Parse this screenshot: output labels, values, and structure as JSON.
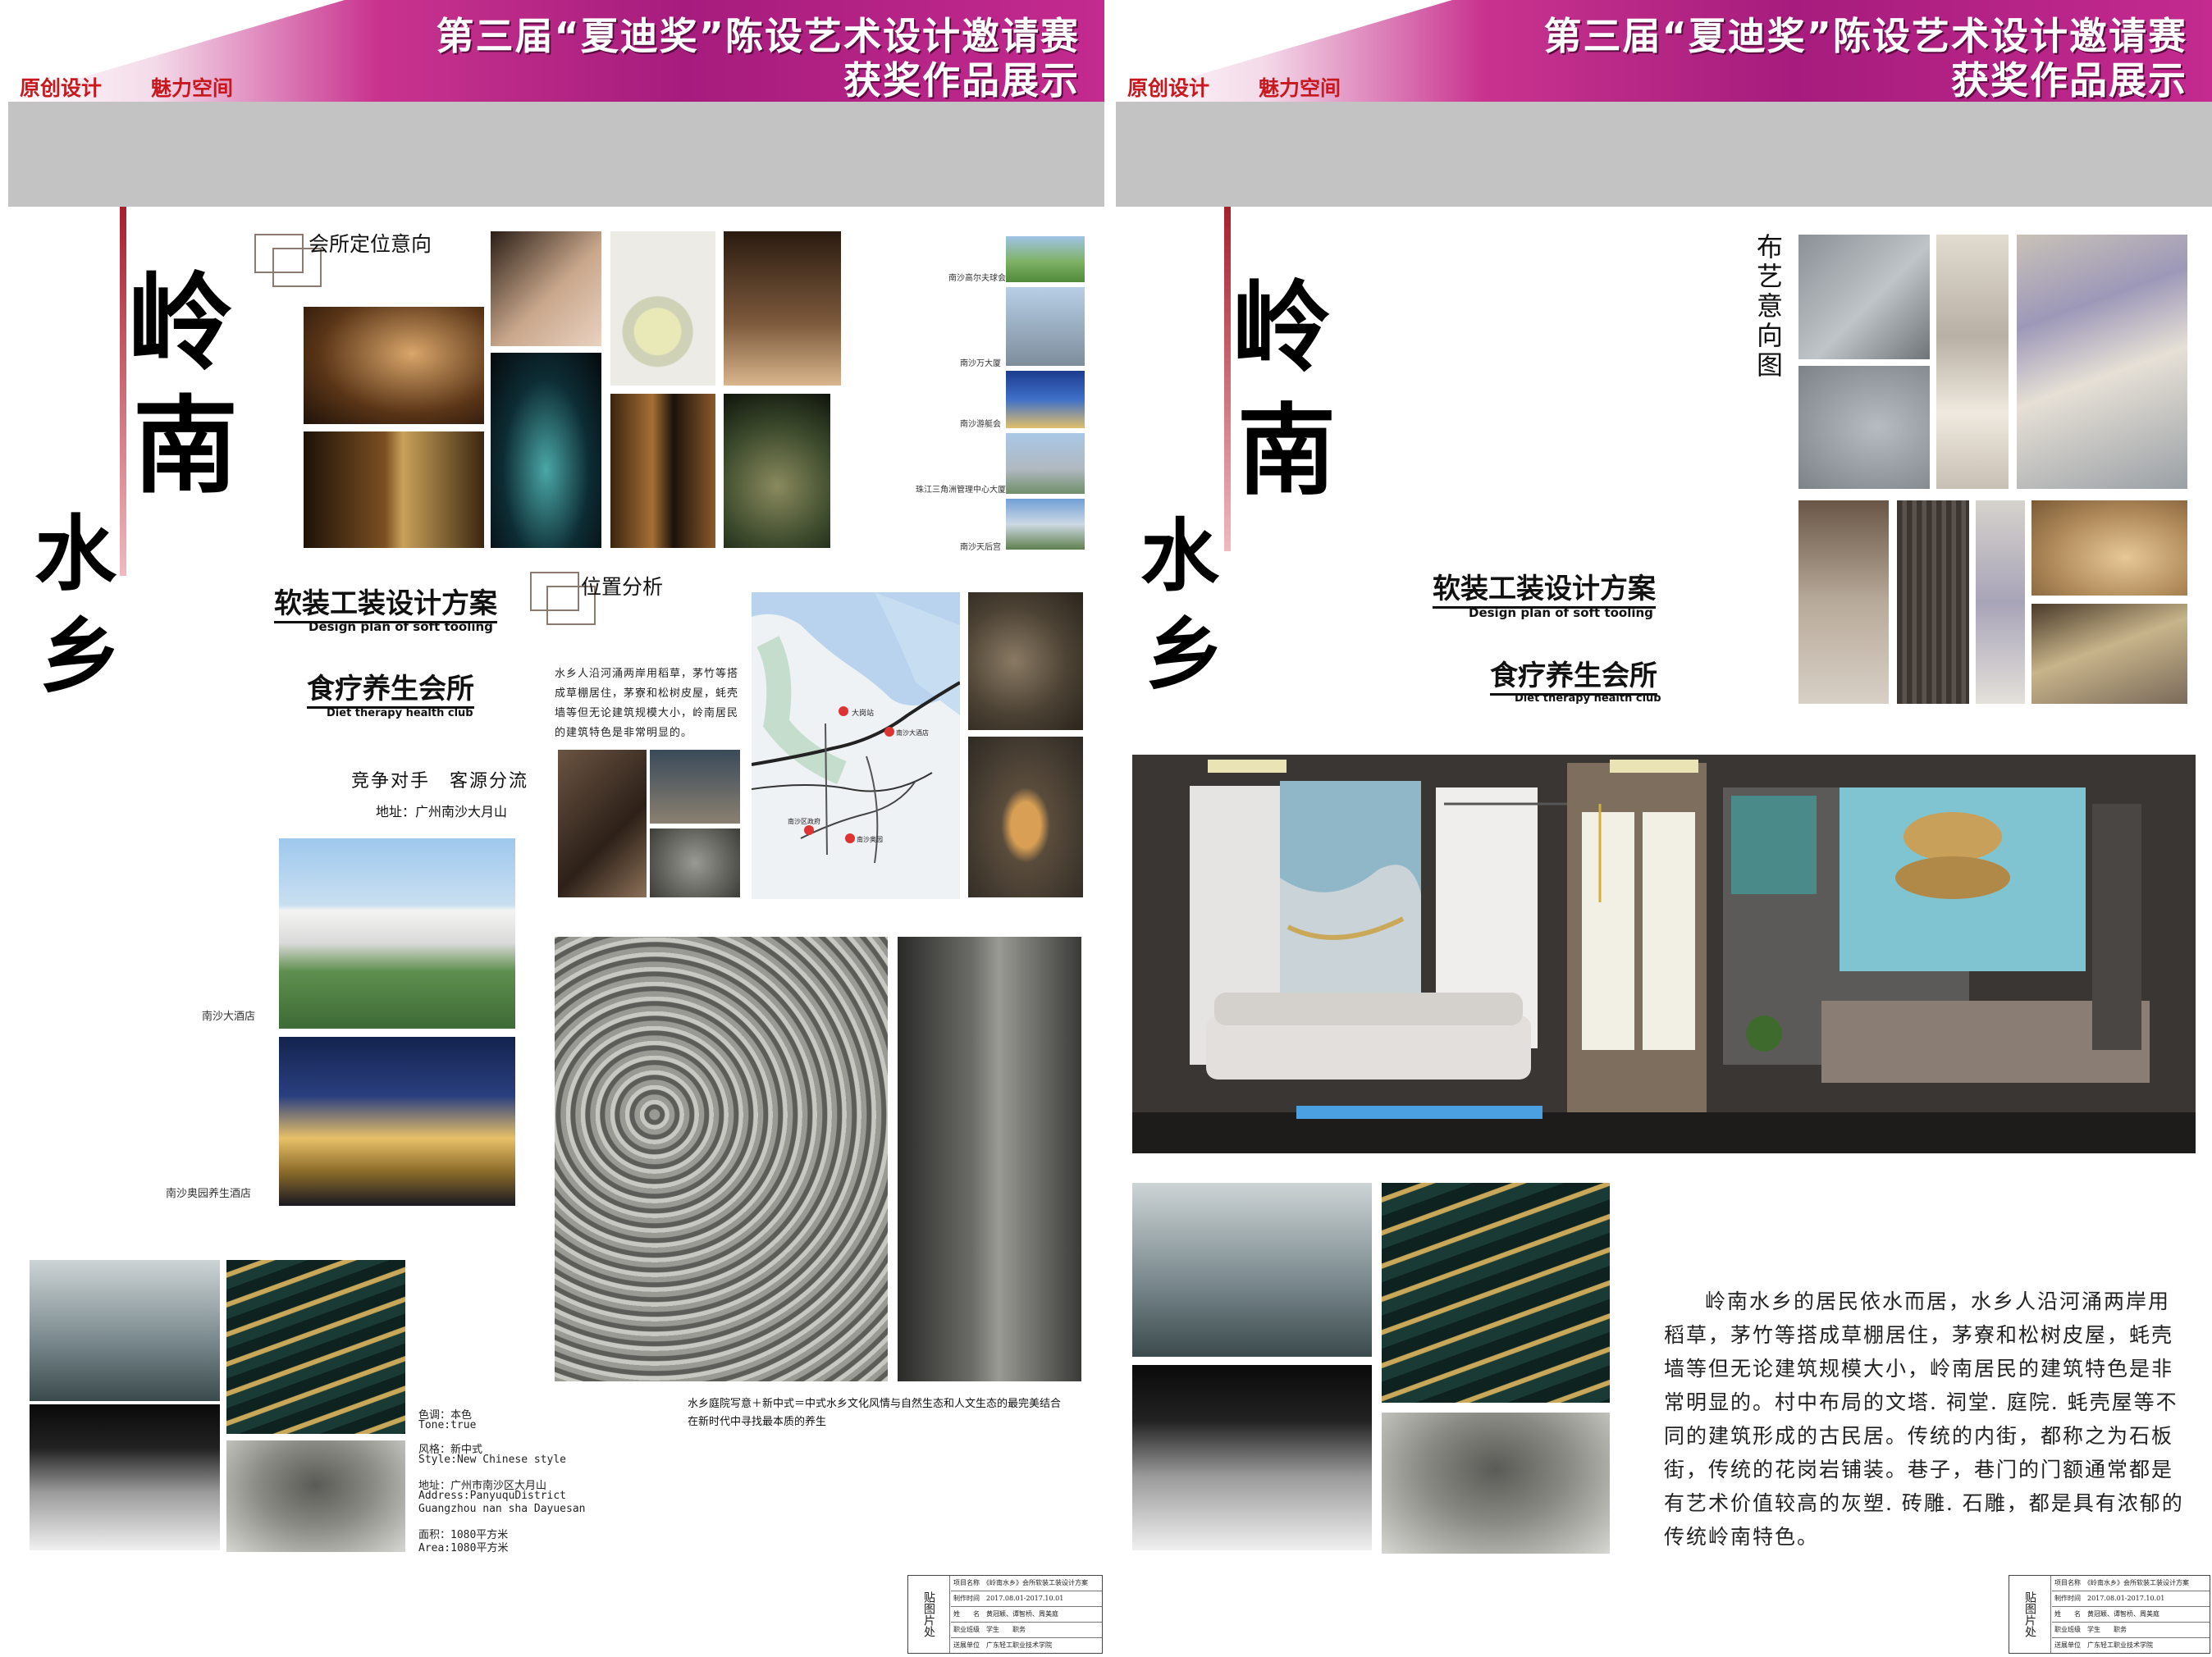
{
  "banner": {
    "line1": "第三届“夏迪奖”陈设艺术设计邀请赛",
    "line2": "获奖作品展示",
    "tag1": "原创设计",
    "tag2": "魅力空间"
  },
  "left_board": {
    "title_chars": [
      "岭",
      "南",
      "水",
      "乡"
    ],
    "section_positioning": "会所定位意向",
    "section_location": "位置分析",
    "plan_title_cn": "软装工装设计方案",
    "plan_title_en": "Design plan of soft tooling",
    "club_title_cn": "食疗养生会所",
    "club_title_en": "Diet therapy health club",
    "competitor": "竞争对手　客源分流",
    "address_line": "地址：广州南沙大月山",
    "hotel1": "南沙大酒店",
    "hotel2": "南沙奥园养生酒店",
    "side_captions": [
      "南沙高尔夫球会",
      "南沙万大厦",
      "南沙游艇会",
      "珠江三角洲管理中心大厦",
      "南沙天后宫"
    ],
    "location_text": "水乡人沿河涌两岸用稻草，茅竹等搭成草棚居住，茅寮和松树皮屋，蚝壳墙等但无论建筑规模大小，岭南居民的建筑特色是非常明显的。",
    "concept_line1": "水乡庭院写意＋新中式＝中式水乡文化风情与自然生态和人文生态的最完美结合",
    "concept_line2": "在新时代中寻找最本质的养生",
    "specs": {
      "tone": "色调：本色",
      "tone_en": "Tone:true",
      "style": "风格：新中式",
      "style_en": "Style:New Chinese style",
      "addr": "地址：广州市南沙区大月山",
      "addr_en1": "Address:PanyuquDistrict",
      "addr_en2": "Guangzhou nan sha Dayuesan",
      "area": "面积：1080平方米",
      "area_en": "Area:1080平方米"
    },
    "map_labels": [
      "大岗站",
      "南沙大酒店",
      "南沙奥园",
      "南沙区政府"
    ]
  },
  "right_board": {
    "title_chars": [
      "岭",
      "南",
      "水",
      "乡"
    ],
    "fabric_title": "布艺意向图",
    "plan_title_cn": "软装工装设计方案",
    "plan_title_en": "Design plan of soft tooling",
    "club_title_cn": "食疗养生会所",
    "club_title_en": "Diet therapy health club",
    "paragraph": "岭南水乡的居民依水而居，水乡人沿河涌两岸用稻草，茅竹等搭成草棚居住，茅寮和松树皮屋，蚝壳墙等但无论建筑规模大小，岭南居民的建筑特色是非常明显的。村中布局的文塔. 祠堂. 庭院. 蚝壳屋等不同的建筑形成的古民居。传统的内街，都称之为石板街，传统的花岗岩铺装。巷子，巷门的门额通常都是有艺术价值较高的灰塑. 砖雕. 石雕，都是具有浓郁的传统岭南特色。"
  },
  "stamp": {
    "seal": "贴图片处",
    "rows": [
      "项目名称　《岭南水乡》会所软装工装设计方案",
      "制作时间　2017.08.01-2017.10.01",
      "姓　　名　黄冠颖、谭智桥、周美庭",
      "职业班级　学生　　职务",
      "送展单位　广东轻工职业技术学院"
    ]
  },
  "colors": {
    "banner_magenta": "#a61c7d",
    "tag_red": "#c8181e",
    "accent_line": "#a81f2e"
  }
}
